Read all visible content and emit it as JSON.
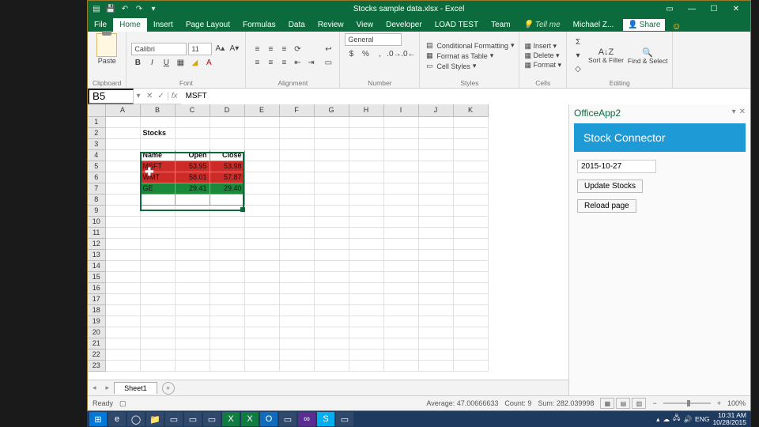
{
  "title": "Stocks sample data.xlsx - Excel",
  "tabs": [
    "File",
    "Home",
    "Insert",
    "Page Layout",
    "Formulas",
    "Data",
    "Review",
    "View",
    "Developer",
    "LOAD TEST",
    "Team"
  ],
  "active_tab": "Home",
  "tellme": "Tell me",
  "account": "Michael Z...",
  "share": "Share",
  "ribbon": {
    "clipboard": "Clipboard",
    "paste": "Paste",
    "font": "Font",
    "font_name": "Calibri",
    "font_size": "11",
    "alignment": "Alignment",
    "number": "Number",
    "number_format": "General",
    "styles": "Styles",
    "cond_fmt": "Conditional Formatting",
    "fmt_table": "Format as Table",
    "cell_styles": "Cell Styles",
    "cells": "Cells",
    "insert": "Insert",
    "delete": "Delete",
    "format": "Format",
    "editing": "Editing",
    "sort": "Sort & Filter",
    "find": "Find & Select"
  },
  "namebox": "B5",
  "formula": "MSFT",
  "columns": [
    "A",
    "B",
    "C",
    "D",
    "E",
    "F",
    "G",
    "H",
    "I",
    "J",
    "K"
  ],
  "rows_count": 23,
  "stock_title": "Stocks",
  "headers": {
    "name": "Name",
    "open": "Open",
    "close": "Close"
  },
  "data": [
    {
      "name": "MSFT",
      "open": "53.95",
      "close": "53.98",
      "color": "red"
    },
    {
      "name": "WMT",
      "open": "58.01",
      "close": "57.87",
      "color": "red"
    },
    {
      "name": "GE",
      "open": "29.41",
      "close": "29.40",
      "color": "green"
    }
  ],
  "sheet_tab": "Sheet1",
  "taskpane": {
    "title": "OfficeApp2",
    "banner": "Stock Connector",
    "date": "2015-10-27",
    "update": "Update Stocks",
    "reload": "Reload page"
  },
  "status": {
    "ready": "Ready",
    "average": "Average: 47.00666633",
    "count": "Count: 9",
    "sum": "Sum: 282.039998",
    "zoom": "100%"
  },
  "clock": {
    "time": "10:31 AM",
    "date": "10/28/2015",
    "lang": "ENG"
  }
}
